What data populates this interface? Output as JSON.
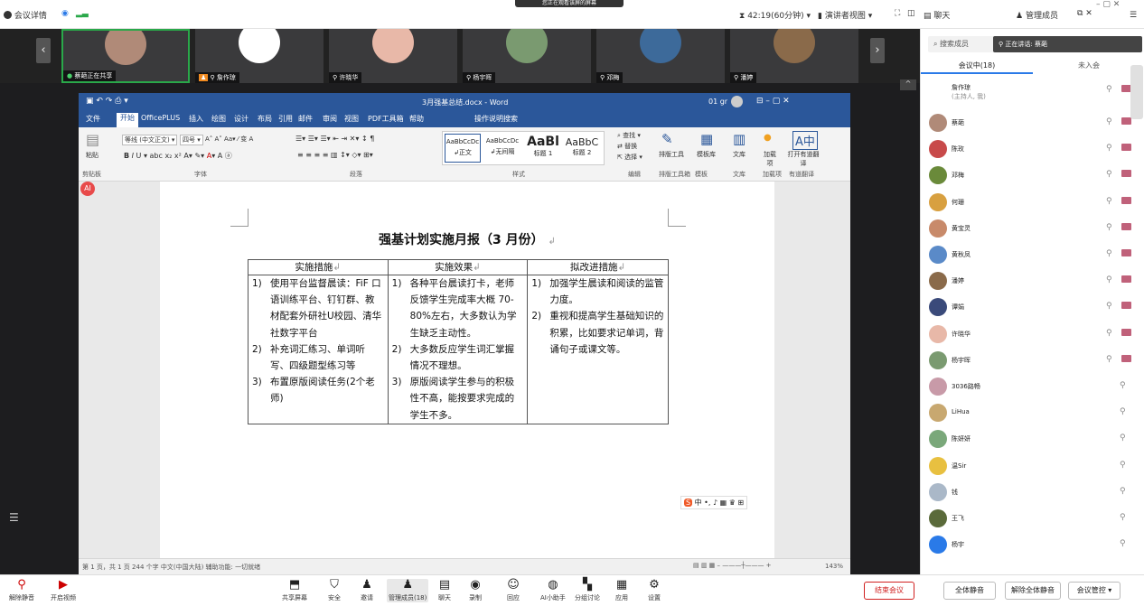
{
  "topbar": {
    "meeting_info": "会议详情",
    "timer": "42:19(60分钟)",
    "presenter_view": "演讲者视图",
    "chat": "聊天",
    "manage": "管理成员",
    "sharing_banner": "您正在观看该屏的屏幕"
  },
  "strip": {
    "tiles": [
      {
        "name": "蔡葩正在共享",
        "color": "#b08a78"
      },
      {
        "name": "詹作琼",
        "color": "#ffffff"
      },
      {
        "name": "许晓华",
        "color": "#e8b8a8"
      },
      {
        "name": "杨宇晖",
        "color": "#7a9a70"
      },
      {
        "name": "邓梅",
        "color": "#3d6a9a"
      },
      {
        "name": "潘婷",
        "color": "#8a6a4a"
      }
    ]
  },
  "word": {
    "title": "3月强基总结.docx - Word",
    "user": "01 gr",
    "tabs": [
      "文件",
      "开始",
      "OfficePLUS",
      "插入",
      "绘图",
      "设计",
      "布局",
      "引用",
      "邮件",
      "审阅",
      "视图",
      "PDF工具箱",
      "帮助",
      "操作说明搜索"
    ],
    "ribbon": {
      "paste": "粘贴",
      "font_name": "等线 (中文正文)",
      "font_size": "四号",
      "styles": [
        {
          "prev": "AaBbCcDc",
          "name": "正文"
        },
        {
          "prev": "AaBbCcDc",
          "name": "无间隔"
        },
        {
          "prev": "AaBl",
          "name": "标题 1"
        },
        {
          "prev": "AaBbC",
          "name": "标题 2"
        }
      ],
      "find": "查找",
      "replace": "替换",
      "select": "选择",
      "typeset": "排版工具",
      "template": "模板库",
      "library": "文库",
      "addin": "加载项",
      "translate": "打开有道翻译",
      "groups": [
        "剪贴板",
        "字体",
        "段落",
        "样式",
        "编辑",
        "排版工具箱",
        "模板",
        "文库",
        "加载项",
        "有道翻译"
      ]
    },
    "doc_title": "强基计划实施月报（3 月份）",
    "headers": [
      "实施措施",
      "实施效果",
      "拟改进措施"
    ],
    "col1": [
      {
        "n": "1)",
        "t": "使用平台监督晨读：FiF 口语训练平台、钉钉群、教材配套外研社U校园、清华社数字平台"
      },
      {
        "n": "2)",
        "t": "补充词汇练习、单词听写、四级题型练习等"
      },
      {
        "n": "3)",
        "t": "布置原版阅读任务(2个老师)"
      }
    ],
    "col2": [
      {
        "n": "1)",
        "t": "各种平台晨读打卡，老师反馈学生完成率大概 70-80%左右，大多数认为学生缺乏主动性。"
      },
      {
        "n": "2)",
        "t": "大多数反应学生词汇掌握情况不理想。"
      },
      {
        "n": "3)",
        "t": "原版阅读学生参与的积极性不高，能按要求完成的学生不多。"
      }
    ],
    "col3": [
      {
        "n": "1)",
        "t": "加强学生晨读和阅读的监管力度。"
      },
      {
        "n": "2)",
        "t": "重视和提高学生基础知识的积累，比如要求记单词，背诵句子或课文等。"
      }
    ],
    "status": "第 1 页，共 1 页    244 个字    中文(中国大陆)    辅助功能: 一切就绪",
    "zoom": "143%"
  },
  "side": {
    "search": "搜索成员",
    "speaking": "正在讲话: 蔡葩",
    "tab_in": "会议中(18)",
    "tab_out": "未入会",
    "host": {
      "name": "詹作琼",
      "sub": "(主持人, 我)"
    },
    "members": [
      {
        "name": "蔡葩",
        "color": "#b08a78",
        "cam": true
      },
      {
        "name": "陈玫",
        "color": "#c84a4a",
        "cam": true
      },
      {
        "name": "邓梅",
        "color": "#6a8a3a",
        "cam": true
      },
      {
        "name": "何珊",
        "color": "#d8a040",
        "cam": true
      },
      {
        "name": "黄宝灵",
        "color": "#c88a6a",
        "cam": true
      },
      {
        "name": "黄秋凤",
        "color": "#5a8ac8",
        "cam": true
      },
      {
        "name": "潘婷",
        "color": "#8a6a4a",
        "cam": true
      },
      {
        "name": "谭娟",
        "color": "#3a4a7a",
        "cam": true
      },
      {
        "name": "许晓华",
        "color": "#e8b8a8",
        "cam": true
      },
      {
        "name": "杨宇晖",
        "color": "#7a9a70",
        "cam": true
      },
      {
        "name": "3036路畅",
        "color": "#c89aa8",
        "cam": false
      },
      {
        "name": "LiHua",
        "color": "#c8a870",
        "cam": false
      },
      {
        "name": "陈妍妍",
        "color": "#7aa87a",
        "cam": false
      },
      {
        "name": "温Sir",
        "color": "#e8c040",
        "cam": false
      },
      {
        "name": "钱",
        "color": "#aab8c8",
        "cam": false
      },
      {
        "name": "王飞",
        "color": "#5a6a3a",
        "cam": false
      },
      {
        "name": "杨宇",
        "color": "#2a7ae8",
        "cam": false
      }
    ]
  },
  "bottom": {
    "mute": "解除静音",
    "video": "开启视频",
    "end": "结束会议",
    "mute_all": "全体静音",
    "unmute_all": "解除全体静音",
    "control": "会议管控",
    "items": [
      "共享屏幕",
      "安全",
      "邀请",
      "管理成员(18)",
      "聊天",
      "录制",
      "回应",
      "AI小助手",
      "分组讨论",
      "应用",
      "设置"
    ]
  }
}
